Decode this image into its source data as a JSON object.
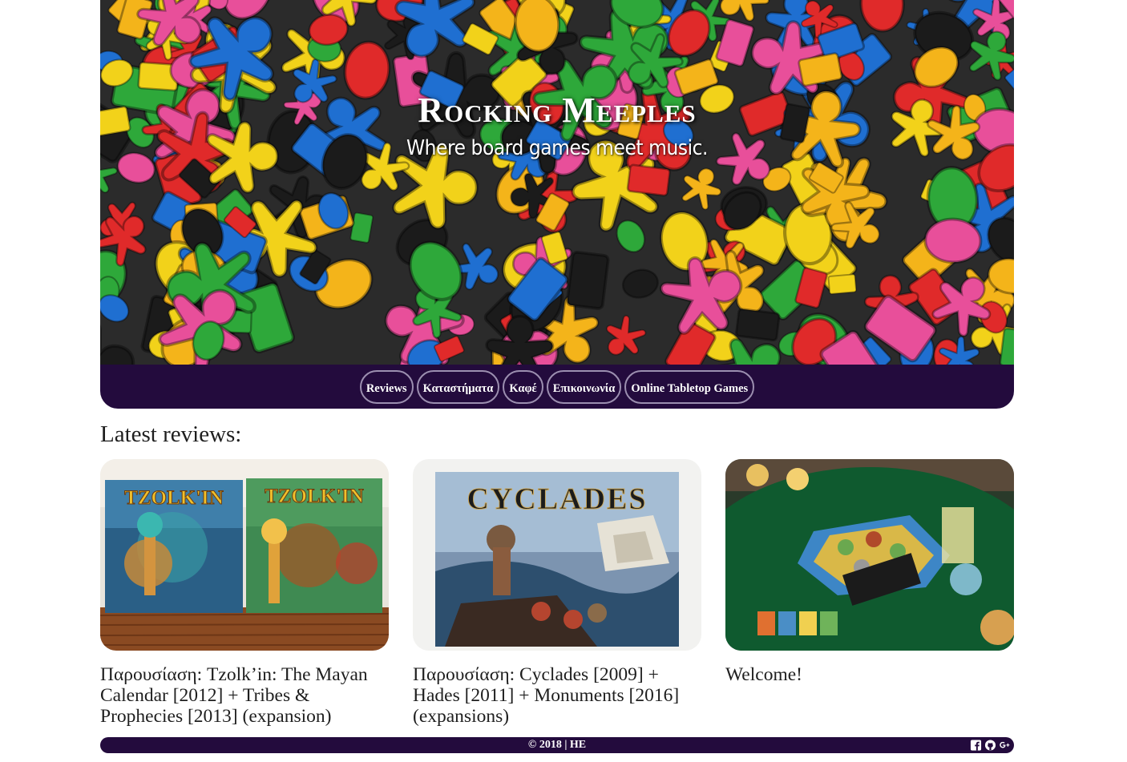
{
  "header": {
    "title": "Rocking Meeples",
    "subtitle": "Where board games meet music."
  },
  "nav": {
    "items": [
      {
        "label": "Reviews"
      },
      {
        "label": "Καταστήματα"
      },
      {
        "label": "Καφέ"
      },
      {
        "label": "Επικοινωνία"
      },
      {
        "label": "Online Tabletop Games"
      }
    ]
  },
  "main": {
    "section_title": "Latest reviews:",
    "cards": [
      {
        "title": "Παρουσίαση: Tzolk’in: The Mayan Calendar [2012] + Tribes & Prophecies [2013] (expansion)",
        "image_text_1": "TZOLK'IN",
        "image_text_2": "TZOLK'IN"
      },
      {
        "title": "Παρουσίαση: Cyclades [2009] + Hades [2011] + Monuments [2016] (expansions)",
        "image_text_1": "CYCLADES"
      },
      {
        "title": "Welcome!"
      }
    ]
  },
  "footer": {
    "text": "© 2018 | HE",
    "icons": [
      "facebook-icon",
      "github-icon",
      "google-plus-icon"
    ]
  },
  "colors": {
    "brand_dark": "#230b3d",
    "nav_border": "#9c8fb0",
    "text": "#1e1e1e"
  }
}
